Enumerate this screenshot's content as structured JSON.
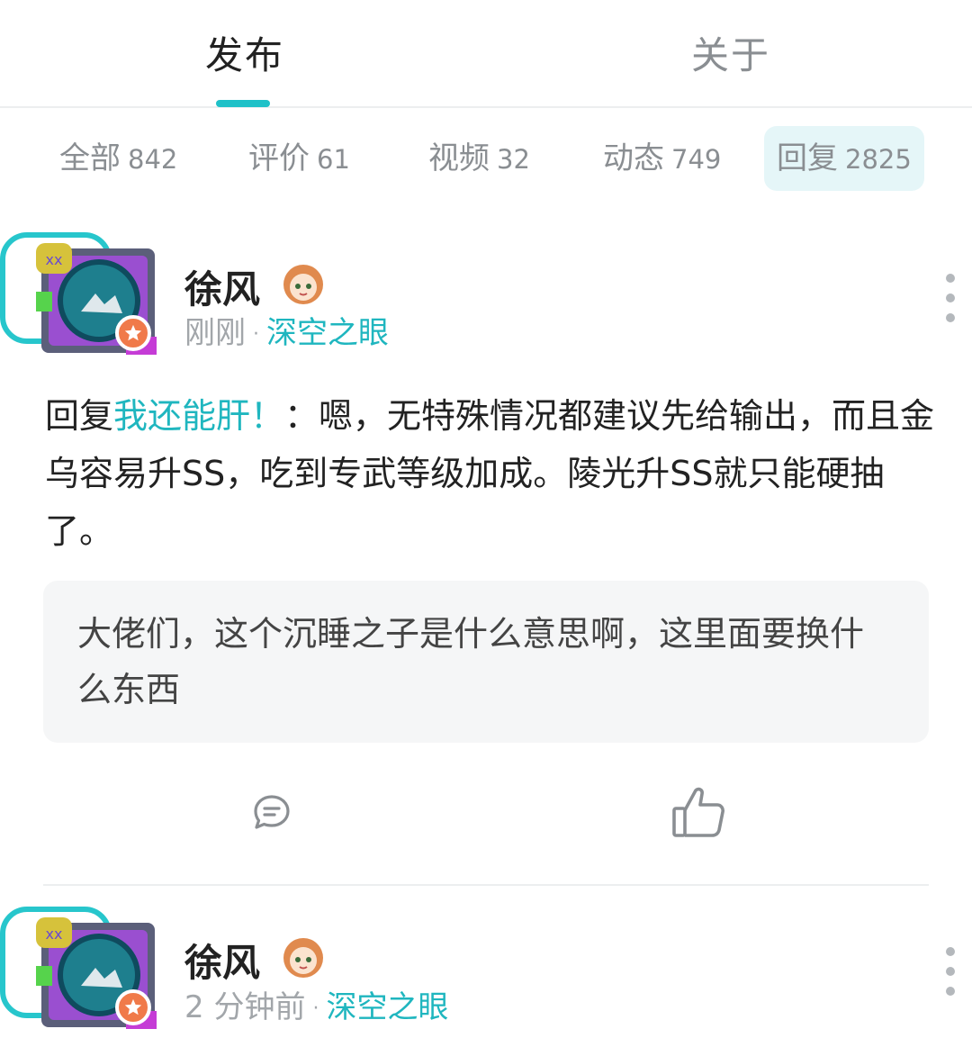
{
  "tabs": {
    "publish": "发布",
    "about": "关于"
  },
  "filters": [
    {
      "label": "全部",
      "count": "842"
    },
    {
      "label": "评价",
      "count": "61"
    },
    {
      "label": "视频",
      "count": "32"
    },
    {
      "label": "动态",
      "count": "749"
    },
    {
      "label": "回复",
      "count": "2825"
    }
  ],
  "colors": {
    "accent": "#1fc1c8",
    "link": "#1fb6bf"
  },
  "posts": [
    {
      "user": "徐风",
      "time": "刚刚",
      "separator": "·",
      "game": "深空之眼",
      "reply_prefix": "回复",
      "reply_target": "我还能肝！",
      "reply_text": "：嗯，无特殊情况都建议先给输出，而且金乌容易升SS，吃到专武等级加成。陵光升SS就只能硬抽了。",
      "quote": "大佬们，这个沉睡之子是什么意思啊，这里面要换什么东西",
      "icons": {
        "comment": "comment-icon",
        "like": "thumbs-up-icon",
        "more": "more-vertical-icon"
      }
    },
    {
      "user": "徐风",
      "time": "2 分钟前",
      "separator": "·",
      "game": "深空之眼"
    }
  ]
}
